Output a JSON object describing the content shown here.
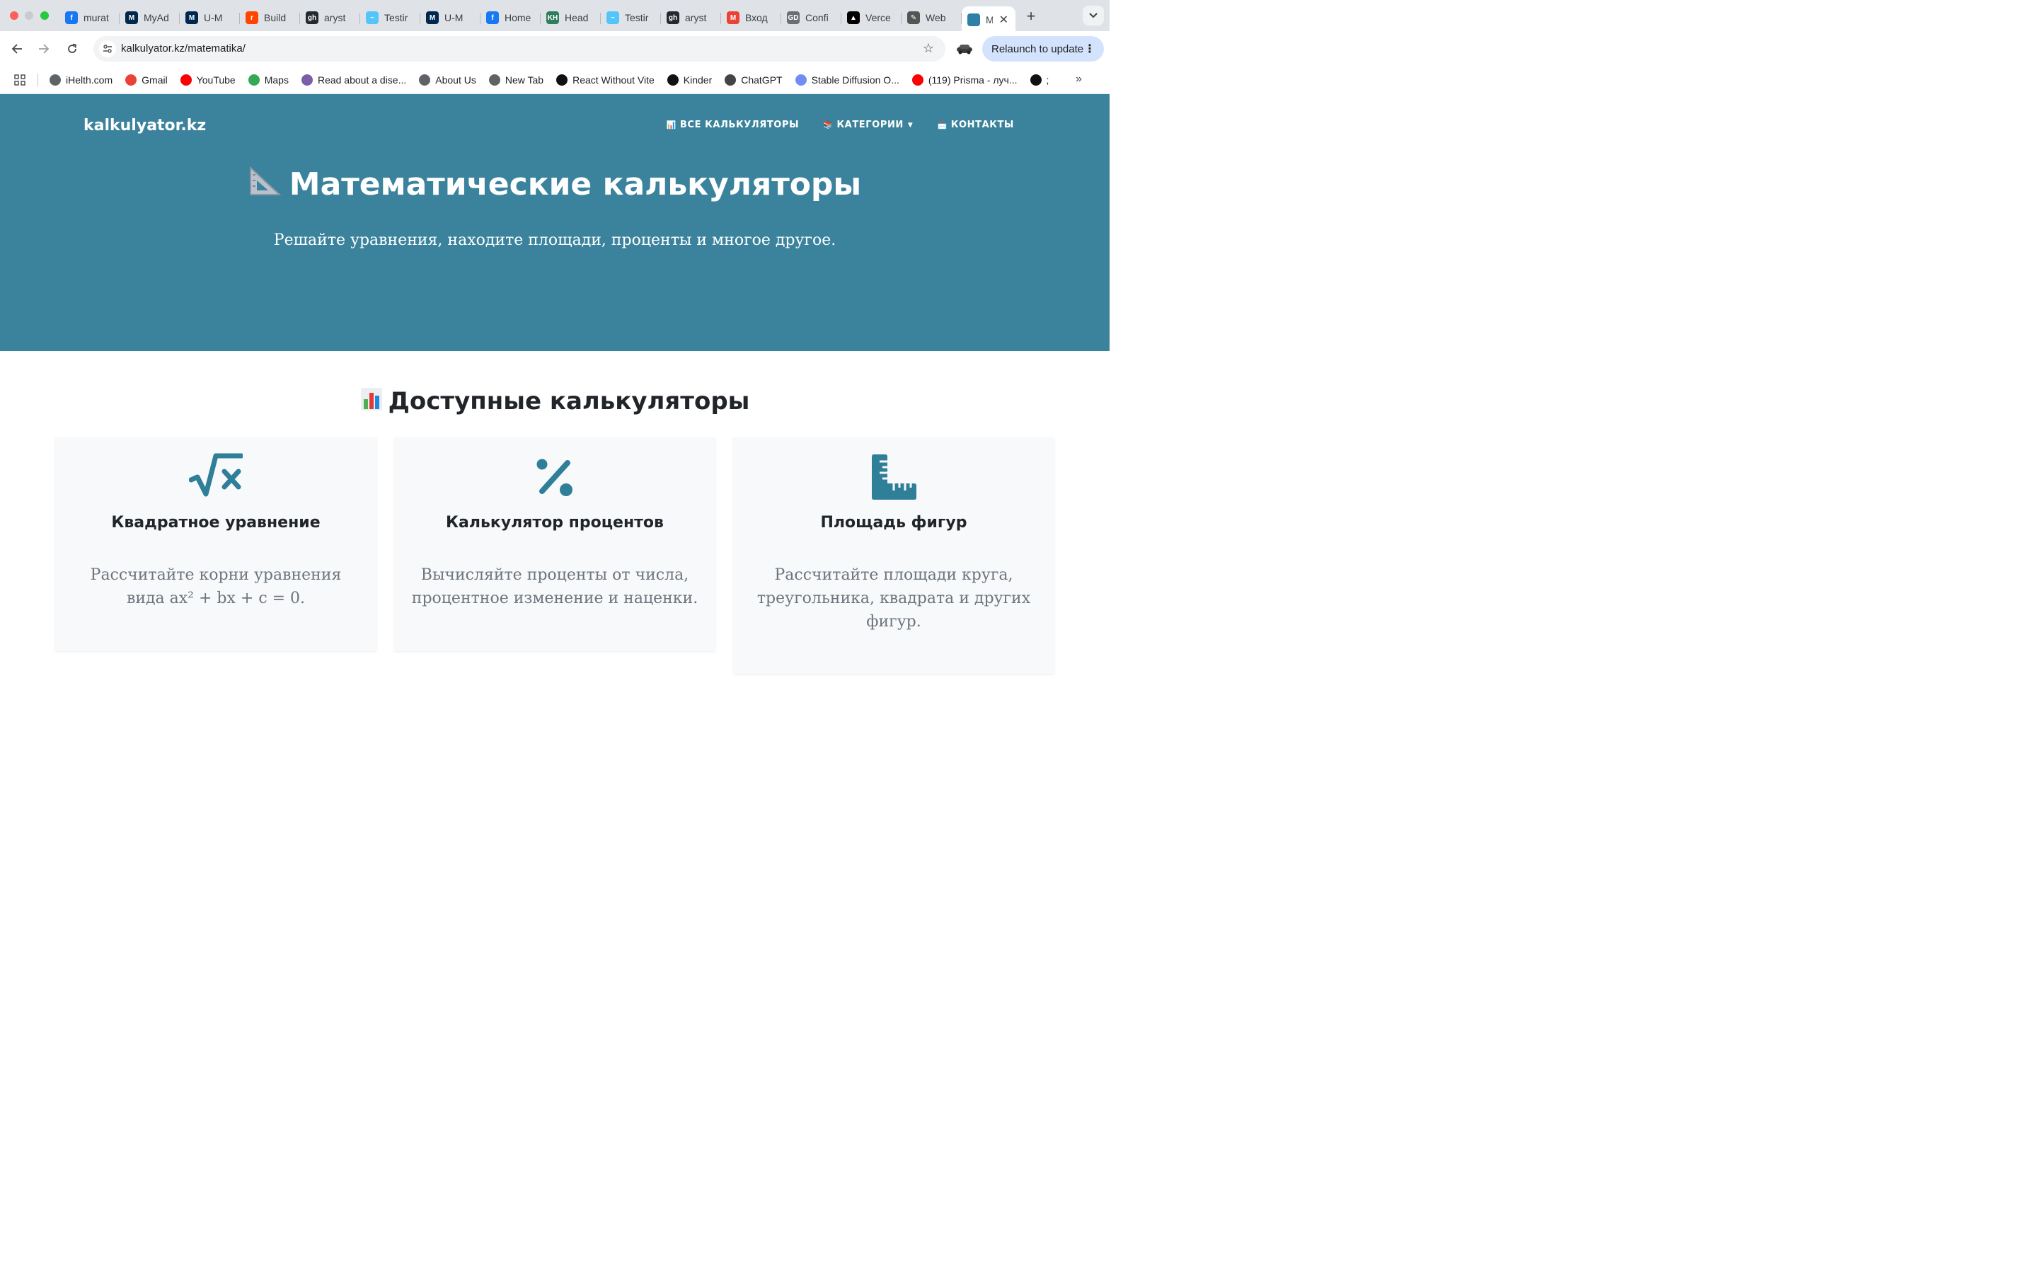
{
  "browser": {
    "tabs": [
      {
        "label": "murat",
        "fav_color": "#1877f2",
        "fav_glyph": "f"
      },
      {
        "label": "MyAd",
        "fav_color": "#00274c",
        "fav_glyph": "M"
      },
      {
        "label": "U-M",
        "fav_color": "#00274c",
        "fav_glyph": "M"
      },
      {
        "label": "Build",
        "fav_color": "#ff4500",
        "fav_glyph": "r"
      },
      {
        "label": "aryst",
        "fav_color": "#24292f",
        "fav_glyph": "gh"
      },
      {
        "label": "Testir",
        "fav_color": "#54c5f8",
        "fav_glyph": "~"
      },
      {
        "label": "U-M",
        "fav_color": "#00274c",
        "fav_glyph": "M"
      },
      {
        "label": "Home",
        "fav_color": "#1877f2",
        "fav_glyph": "f"
      },
      {
        "label": "Head",
        "fav_color": "#2e7d5b",
        "fav_glyph": "KH"
      },
      {
        "label": "Testir",
        "fav_color": "#54c5f8",
        "fav_glyph": "~"
      },
      {
        "label": "aryst",
        "fav_color": "#24292f",
        "fav_glyph": "gh"
      },
      {
        "label": "Вход",
        "fav_color": "#ea4335",
        "fav_glyph": "M"
      },
      {
        "label": "Confi",
        "fav_color": "#6b6f74",
        "fav_glyph": "GD"
      },
      {
        "label": "Verce",
        "fav_color": "#000000",
        "fav_glyph": "▲"
      },
      {
        "label": "Web",
        "fav_color": "#555555",
        "fav_glyph": "✎"
      }
    ],
    "active_tab": {
      "label": "M",
      "fav_color": "#2f7fa8"
    },
    "url": "kalkulyator.kz/matematika/",
    "relaunch_label": "Relaunch to update",
    "bookmarks": [
      {
        "label": "iHelth.com",
        "fav_color": "#5f6368"
      },
      {
        "label": "Gmail",
        "fav_color": "#ea4335"
      },
      {
        "label": "YouTube",
        "fav_color": "#ff0000"
      },
      {
        "label": "Maps",
        "fav_color": "#34a853"
      },
      {
        "label": "Read about a dise...",
        "fav_color": "#7b5ea7"
      },
      {
        "label": "About Us",
        "fav_color": "#5f6368"
      },
      {
        "label": "New Tab",
        "fav_color": "#5f6368"
      },
      {
        "label": "React Without Vite",
        "fav_color": "#111111"
      },
      {
        "label": "Kinder",
        "fav_color": "#111111"
      },
      {
        "label": "ChatGPT",
        "fav_color": "#444444"
      },
      {
        "label": "Stable Diffusion O...",
        "fav_color": "#6f8df7"
      },
      {
        "label": "(119) Prisma - луч...",
        "fav_color": "#ff0000"
      },
      {
        "label": ";",
        "fav_color": "#111111"
      }
    ]
  },
  "site": {
    "logo": "kalkulyator.kz",
    "nav": [
      {
        "emoji": "📊",
        "label": "ВСЕ КАЛЬКУЛЯТОРЫ"
      },
      {
        "emoji": "📚",
        "label": "КАТЕГОРИИ"
      },
      {
        "emoji": "📩",
        "label": "КОНТАКТЫ"
      }
    ],
    "hero_title": "Математические калькуляторы",
    "hero_subtitle": "Решайте уравнения, находите площади, проценты и многое другое.",
    "section_title": "Доступные калькуляторы",
    "cards": [
      {
        "title": "Квадратное уравнение",
        "desc": "Рассчитайте корни уравнения вида ax² + bx + c = 0.",
        "icon": "square-root-icon"
      },
      {
        "title": "Калькулятор процентов",
        "desc": "Вычисляйте проценты от числа, процентное изменение и наценки.",
        "icon": "percent-icon"
      },
      {
        "title": "Площадь фигур",
        "desc": "Рассчитайте площади круга, треугольника, квадрата и других фигур.",
        "icon": "ruler-combined-icon"
      }
    ],
    "colors": {
      "hero_bg": "#3b839c",
      "accent": "#2f7f99",
      "card_bg": "#f8f9fa"
    }
  }
}
